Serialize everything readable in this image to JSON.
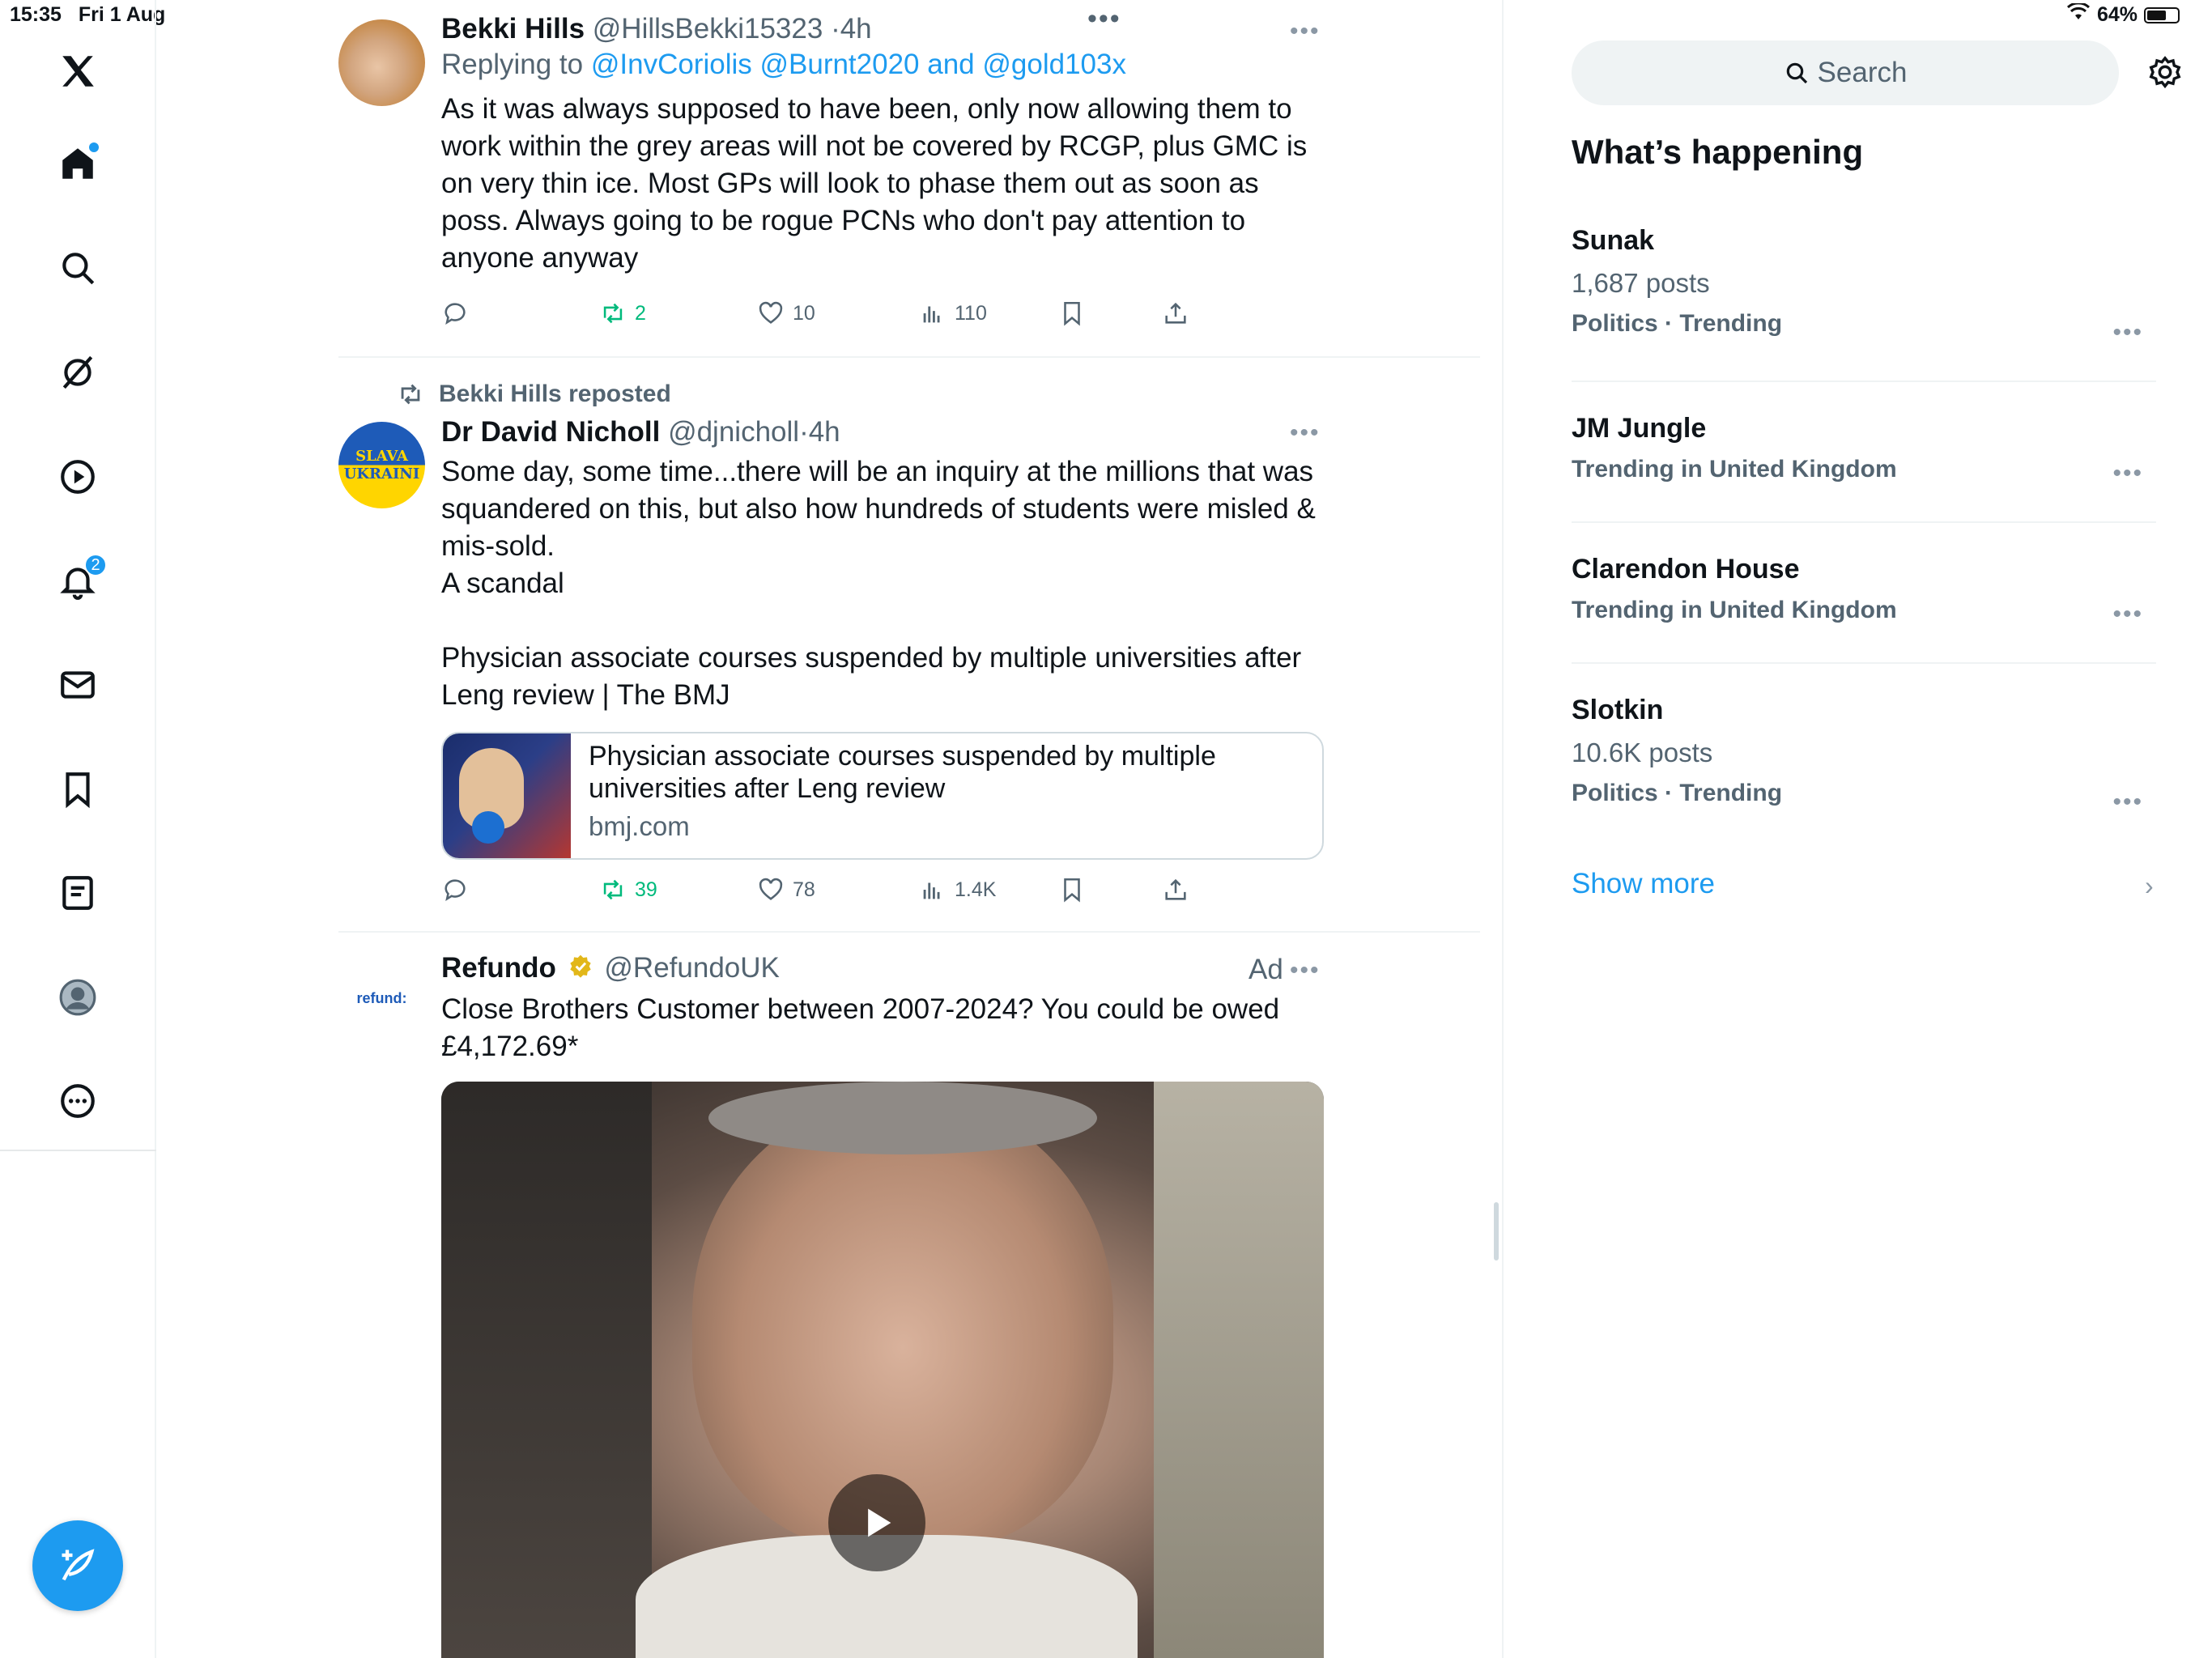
{
  "status_bar": {
    "time": "15:35",
    "date": "Fri 1 Aug",
    "battery": "64%",
    "battery_fraction": 0.64
  },
  "nav": {
    "notifications_count": "2"
  },
  "tweets": [
    {
      "name": "Bekki Hills",
      "handle": "@HillsBekki15323",
      "time": "4h",
      "replying_prefix": "Replying to",
      "replying_to": "@InvCoriolis @Burnt2020 and @gold103x",
      "text": "As it was always supposed to have been, only now allowing them to work within the grey areas will not be covered by RCGP, plus GMC is on very thin ice. Most GPs will look to phase them out as soon as poss. Always going to be rogue PCNs who don't pay attention to anyone anyway",
      "retweets": "2",
      "likes": "10",
      "views": "110"
    },
    {
      "repost_label": "Bekki Hills reposted",
      "name": "Dr David Nicholl",
      "handle": "@djnicholl",
      "time": "4h",
      "avatar_text_1": "SLAVA",
      "avatar_text_2": "UKRAINI",
      "text": "Some day, some time...there will be an inquiry at the millions that was squandered on this, but also how hundreds of students were misled & mis-sold.\nA scandal\n\nPhysician associate courses suspended by multiple universities after Leng review | The BMJ",
      "card_title": "Physician associate courses suspended by multiple universities after Leng review",
      "card_domain": "bmj.com",
      "retweets": "39",
      "likes": "78",
      "views": "1.4K"
    },
    {
      "name": "Refundo",
      "handle": "@RefundoUK",
      "ad_label": "Ad",
      "avatar_text": "refund:",
      "text": "Close Brothers Customer between 2007-2024? You could be owed £4,172.69*"
    }
  ],
  "sidebar": {
    "search_placeholder": "Search",
    "title": "What’s happening",
    "trends": [
      {
        "name": "Sunak",
        "posts": "1,687 posts",
        "context": "Politics · Trending"
      },
      {
        "name": "JM Jungle",
        "posts": "",
        "context": "Trending in United Kingdom"
      },
      {
        "name": "Clarendon House",
        "posts": "",
        "context": "Trending in United Kingdom"
      },
      {
        "name": "Slotkin",
        "posts": "10.6K posts",
        "context": "Politics · Trending"
      }
    ],
    "show_more": "Show more"
  },
  "colors": {
    "accent": "#1d9bf0",
    "retweet_green": "#00ba7c",
    "secondary_text": "#536471"
  }
}
